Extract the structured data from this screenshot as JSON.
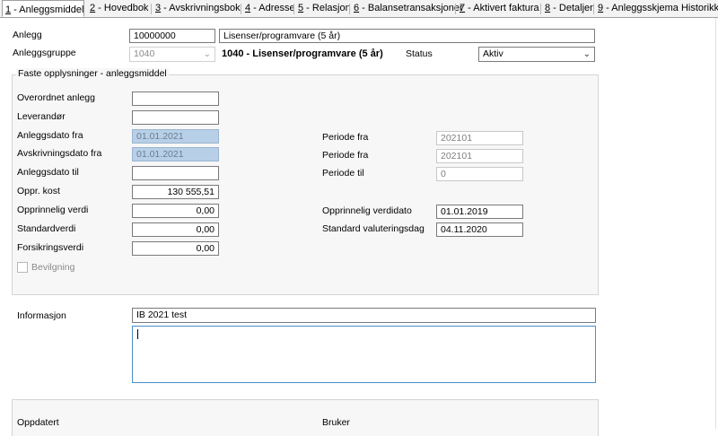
{
  "tabs": [
    {
      "key": "1",
      "label": " - Anleggsmiddel"
    },
    {
      "key": "2",
      "label": " - Hovedbok"
    },
    {
      "key": "3",
      "label": " - Avskrivningsbok"
    },
    {
      "key": "4",
      "label": " - Adresse"
    },
    {
      "key": "5",
      "label": " - Relasjon"
    },
    {
      "key": "6",
      "label": " - Balansetransaksjoner"
    },
    {
      "key": "7",
      "label": " - Aktivert faktura"
    },
    {
      "key": "8",
      "label": " - Detaljer"
    },
    {
      "key": "9",
      "label": " - Anleggsskjema Historikk"
    }
  ],
  "header": {
    "anlegg_label": "Anlegg",
    "anlegg_value": "10000000",
    "anlegg_desc": "Lisenser/programvare (5 år)",
    "gruppe_label": "Anleggsgruppe",
    "gruppe_value": "1040",
    "gruppe_desc": "1040 - Lisenser/programvare (5 år)",
    "status_label": "Status",
    "status_value": "Aktiv"
  },
  "faste": {
    "legend": "Faste opplysninger - anleggsmiddel",
    "overordnet_label": "Overordnet anlegg",
    "overordnet_value": "",
    "leverandor_label": "Leverandør",
    "leverandor_value": "",
    "anleggsdato_fra_label": "Anleggsdato fra",
    "anleggsdato_fra_value": "01.01.2021",
    "avskr_fra_label": "Avskrivningsdato fra",
    "avskr_fra_value": "01.01.2021",
    "anleggsdato_til_label": "Anleggsdato til",
    "anleggsdato_til_value": "",
    "oppr_kost_label": "Oppr. kost",
    "oppr_kost_value": "130 555,51",
    "oppr_verdi_label": "Opprinnelig verdi",
    "oppr_verdi_value": "0,00",
    "standardverdi_label": "Standardverdi",
    "standardverdi_value": "0,00",
    "forsikring_label": "Forsikringsverdi",
    "forsikring_value": "0,00",
    "bevilgning_label": "Bevilgning",
    "periode_fra_label": "Periode fra",
    "periode_fra_value": "202101",
    "periode_fra2_label": "Periode fra",
    "periode_fra2_value": "202101",
    "periode_til_label": "Periode til",
    "periode_til_value": "0",
    "oppr_verdidato_label": "Opprinnelig verdidato",
    "oppr_verdidato_value": "01.01.2019",
    "std_valutering_label": "Standard valuteringsdag",
    "std_valutering_value": "04.11.2020"
  },
  "info": {
    "label": "Informasjon",
    "value": "IB 2021 test",
    "notes": ""
  },
  "footer": {
    "oppdatert_label": "Oppdatert",
    "bruker_label": "Bruker"
  }
}
